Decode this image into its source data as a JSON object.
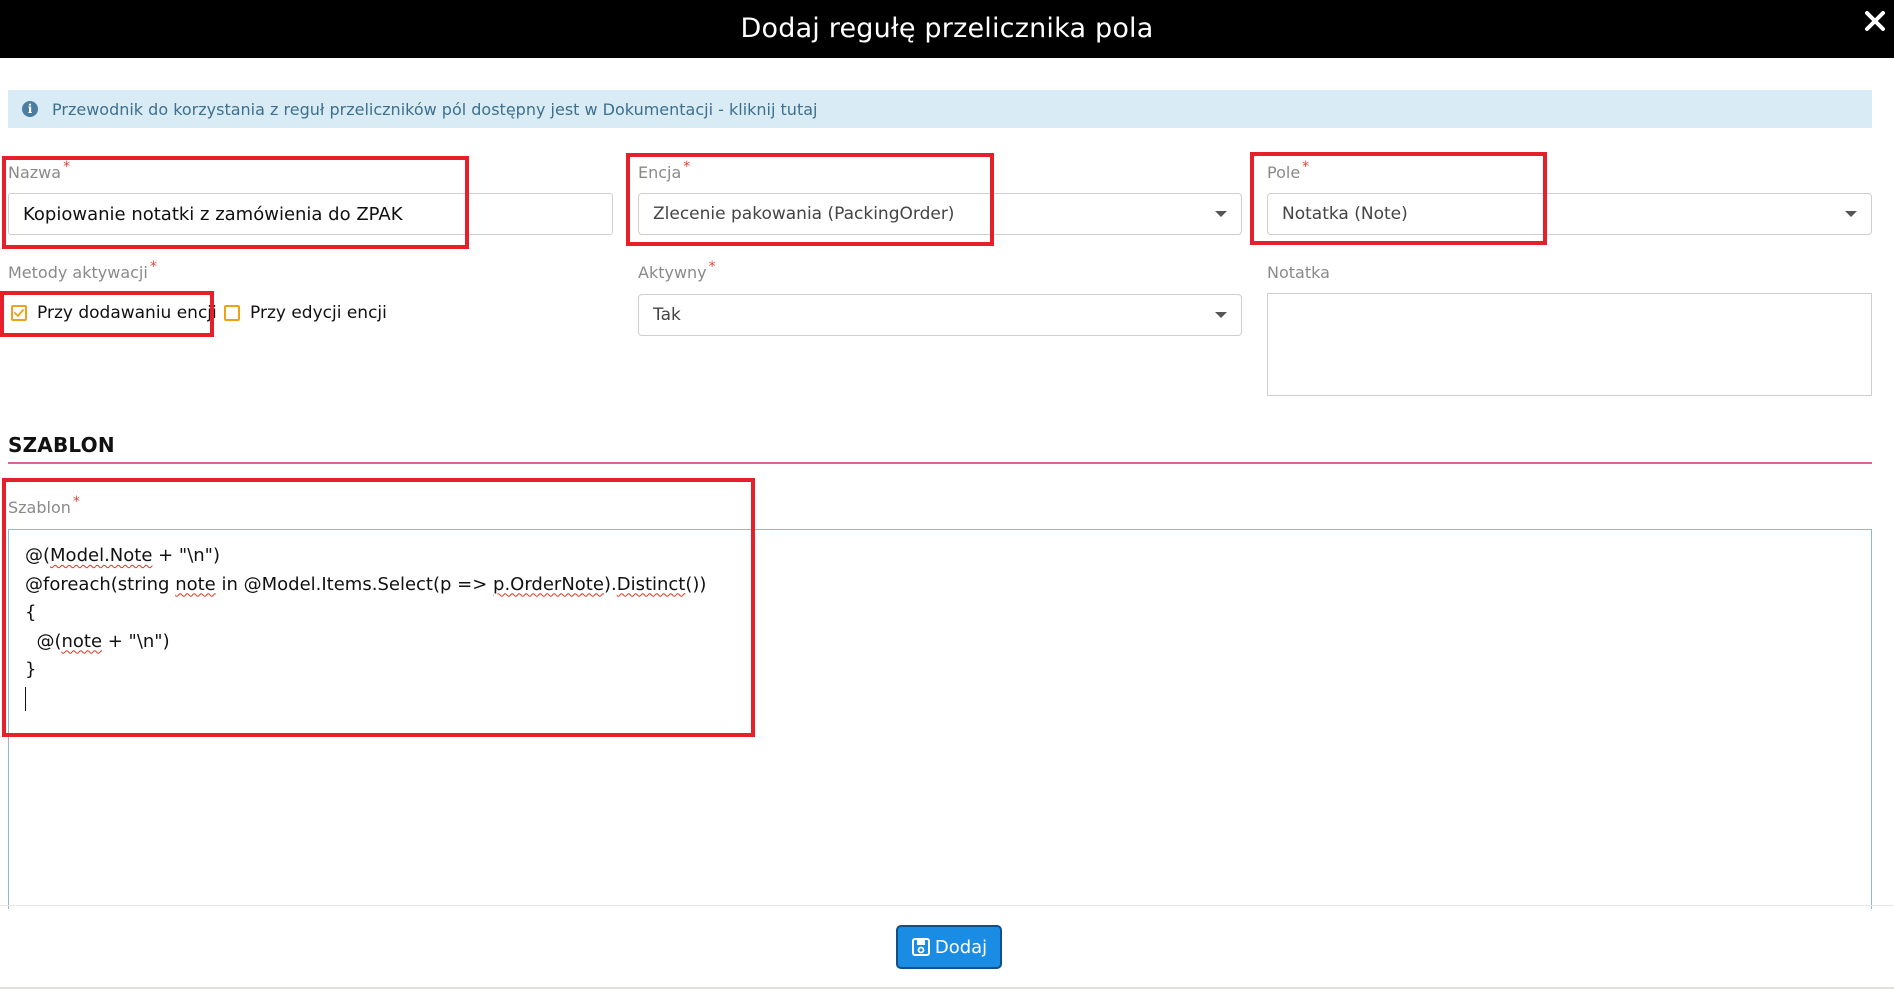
{
  "modal": {
    "title": "Dodaj regułę przelicznika pola"
  },
  "info": {
    "text": "Przewodnik do korzystania z reguł przeliczników pól dostępny jest w Dokumentacji - kliknij tutaj"
  },
  "form": {
    "name": {
      "label": "Nazwa",
      "required_mark": "*",
      "value": "Kopiowanie notatki z zamówienia do ZPAK"
    },
    "entity": {
      "label": "Encja",
      "required_mark": "*",
      "selected": "Zlecenie pakowania (PackingOrder)"
    },
    "field": {
      "label": "Pole",
      "required_mark": "*",
      "selected": "Notatka (Note)"
    },
    "activation_methods": {
      "label": "Metody aktywacji",
      "required_mark": "*",
      "options": [
        {
          "label": "Przy dodawaniu encji",
          "checked": true
        },
        {
          "label": "Przy edycji encji",
          "checked": false
        }
      ]
    },
    "active": {
      "label": "Aktywny",
      "required_mark": "*",
      "selected": "Tak"
    },
    "note": {
      "label": "Notatka",
      "value": ""
    }
  },
  "template_section": {
    "title": "SZABLON",
    "field_label": "Szablon",
    "required_mark": "*",
    "code_lines": [
      [
        {
          "text": "@("
        },
        {
          "text": "Model.Note",
          "squiggle": true
        },
        {
          "text": " + \"\\n\")"
        }
      ],
      [
        {
          "text": "@foreach(string "
        },
        {
          "text": "note",
          "squiggle": true
        },
        {
          "text": " in @Model.Items.Select(p => "
        },
        {
          "text": "p.OrderNote",
          "squiggle": true
        },
        {
          "text": ")."
        },
        {
          "text": "Distinct",
          "squiggle": true
        },
        {
          "text": "())"
        }
      ],
      [
        {
          "text": "{"
        }
      ],
      [
        {
          "text": "  @("
        },
        {
          "text": "note",
          "squiggle": true
        },
        {
          "text": " + \"\\n\")"
        }
      ],
      [
        {
          "text": "}"
        }
      ]
    ]
  },
  "footer": {
    "add_button_label": "Dodaj"
  },
  "colors": {
    "header_bg": "#000000",
    "info_bg": "#d9ecf6",
    "required_red": "#e8443a",
    "checkbox_orange": "#f0a11b",
    "divider_pink": "#e06397",
    "button_blue": "#1a8ce3",
    "highlight_red": "#e5202a"
  },
  "icons": {
    "close": "close-icon",
    "info": "info-icon",
    "dropdown": "chevron-down-icon",
    "check": "check-icon",
    "save": "floppy-disk-icon"
  }
}
